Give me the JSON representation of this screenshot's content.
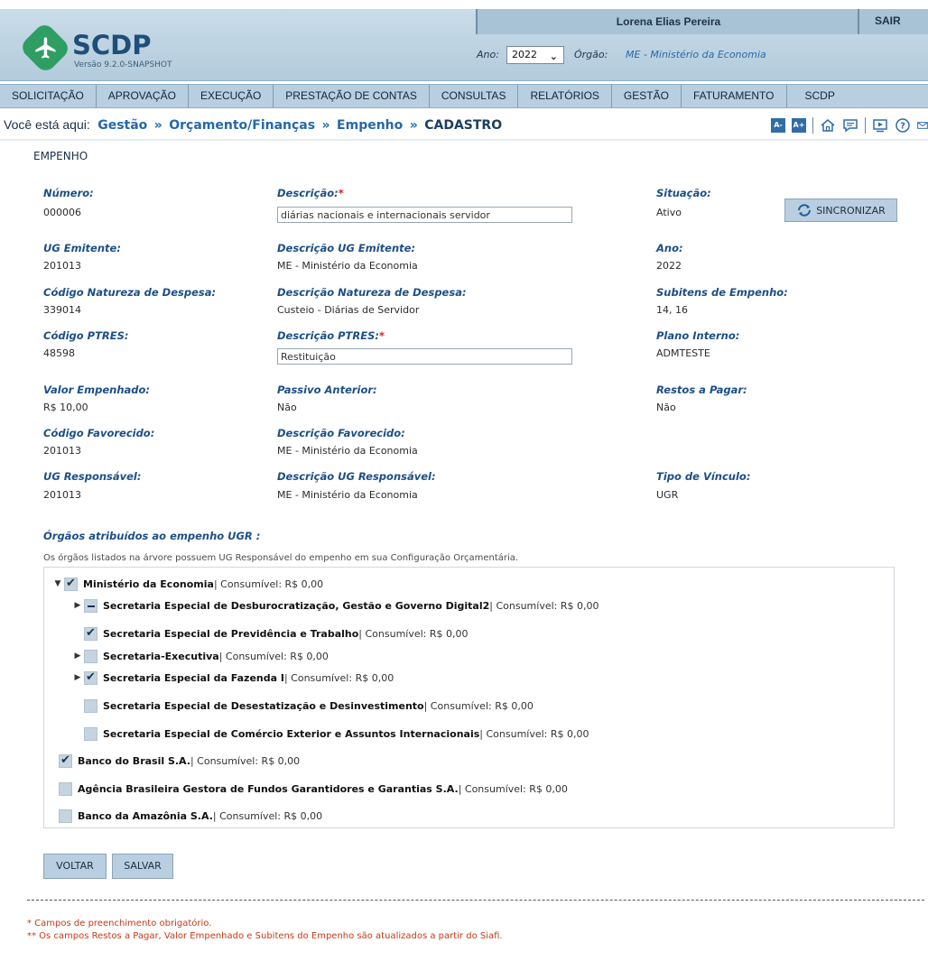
{
  "header": {
    "logo_text": "SCDP",
    "version": "Versão 9.2.0-SNAPSHOT",
    "user_name": "Lorena Elias Pereira",
    "logout_label": "SAIR",
    "year_label": "Ano:",
    "year_value": "2022",
    "org_label": "Órgão:",
    "org_value": "ME - Ministério da Economia"
  },
  "nav": {
    "items": [
      "SOLICITAÇÃO",
      "APROVAÇÃO",
      "EXECUÇÃO",
      "PRESTAÇÃO DE CONTAS",
      "CONSULTAS",
      "RELATÓRIOS",
      "GESTÃO",
      "FATURAMENTO",
      "SCDP"
    ]
  },
  "breadcrumb": {
    "prefix": "Você está aqui:",
    "items": [
      "Gestão",
      "Orçamento/Finanças",
      "Empenho"
    ],
    "current": "CADASTRO"
  },
  "tools": {
    "font_decrease": "A-",
    "font_increase": "A+"
  },
  "page": {
    "title": "EMPENHO"
  },
  "fields": {
    "numero": {
      "label": "Número:",
      "value": "000006"
    },
    "descricao": {
      "label": "Descrição:",
      "value": "diárias nacionais e internacionais servidor"
    },
    "situacao": {
      "label": "Situação:",
      "value": "Ativo"
    },
    "ug_emitente": {
      "label": "UG Emitente:",
      "value": "201013"
    },
    "desc_ug_emitente": {
      "label": "Descrição UG Emitente:",
      "value": "ME - Ministério da Economia"
    },
    "ano": {
      "label": "Ano:",
      "value": "2022"
    },
    "cod_natureza": {
      "label": "Código Natureza de Despesa:",
      "value": "339014"
    },
    "desc_natureza": {
      "label": "Descrição Natureza de Despesa:",
      "value": "Custeio - Diárias de Servidor"
    },
    "subitens": {
      "label": "Subitens de Empenho:",
      "value": "14, 16"
    },
    "cod_ptres": {
      "label": "Código PTRES:",
      "value": "48598"
    },
    "desc_ptres": {
      "label": "Descrição PTRES:",
      "value": "Restituição"
    },
    "plano_interno": {
      "label": "Plano Interno:",
      "value": "ADMTESTE"
    },
    "valor_empenhado": {
      "label": "Valor Empenhado:",
      "value": "R$ 10,00"
    },
    "passivo_anterior": {
      "label": "Passivo Anterior:",
      "value": "Não"
    },
    "restos_pagar": {
      "label": "Restos a Pagar:",
      "value": "Não"
    },
    "cod_favorecido": {
      "label": "Código Favorecido:",
      "value": "201013"
    },
    "desc_favorecido": {
      "label": "Descrição Favorecido:",
      "value": "ME - Ministério da Economia"
    },
    "ug_responsavel": {
      "label": "UG Responsável:",
      "value": "201013"
    },
    "desc_ug_responsavel": {
      "label": "Descrição UG Responsável:",
      "value": "ME - Ministério da Economia"
    },
    "tipo_vinculo": {
      "label": "Tipo de Vínculo:",
      "value": "UGR"
    },
    "required_mark": "*"
  },
  "sync_button": "SINCRONIZAR",
  "orgs": {
    "title": "Órgãos atribuídos ao empenho UGR :",
    "note": "Os órgãos listados na árvore possuem UG Responsável do empenho em sua Configuração Orçamentária.",
    "tree": [
      {
        "name": "Ministério da Economia",
        "rest": " | Consumível: R$ 0,00",
        "state": "checked",
        "toggle": "expanded"
      },
      {
        "name": "Secretaria Especial de Desburocratização, Gestão e Governo Digital2",
        "rest": " | Consumível: R$ 0,00",
        "state": "partial",
        "toggle": "collapsed"
      },
      {
        "name": "Secretaria Especial de Previdência e Trabalho",
        "rest": " | Consumível: R$ 0,00",
        "state": "checked",
        "toggle": "none"
      },
      {
        "name": "Secretaria-Executiva",
        "rest": " | Consumível: R$ 0,00",
        "state": "unchecked",
        "toggle": "collapsed"
      },
      {
        "name": "Secretaria Especial da Fazenda I",
        "rest": " | Consumível: R$ 0,00",
        "state": "checked",
        "toggle": "collapsed"
      },
      {
        "name": "Secretaria Especial de Desestatização e Desinvestimento",
        "rest": " | Consumível: R$ 0,00",
        "state": "unchecked",
        "toggle": "none"
      },
      {
        "name": "Secretaria Especial de Comércio Exterior e Assuntos Internacionais",
        "rest": " | Consumível: R$ 0,00",
        "state": "unchecked",
        "toggle": "none"
      },
      {
        "name": "Banco do Brasil S.A.",
        "rest": " | Consumível: R$ 0,00",
        "state": "checked",
        "toggle": "none"
      },
      {
        "name": "Agência Brasileira Gestora de Fundos Garantidores e Garantias S.A.",
        "rest": " | Consumível: R$ 0,00",
        "state": "unchecked",
        "toggle": "none"
      },
      {
        "name": "Banco da Amazônia S.A.",
        "rest": " | Consumível: R$ 0,00",
        "state": "unchecked",
        "toggle": "none"
      }
    ]
  },
  "buttons": {
    "back": "VOLTAR",
    "save": "SALVAR"
  },
  "footer": {
    "note1": "* Campos de preenchimento obrigatório.",
    "note2": "** Os campos Restos a Pagar, Valor Empenhado e Subitens do Empenho são atualizados a partir do Siafi."
  },
  "colors": {
    "label_blue": "#1c4f86",
    "required_red": "#d0231c",
    "nav_bg": "#b8cfe0",
    "logo_green": "#2f9e62"
  }
}
